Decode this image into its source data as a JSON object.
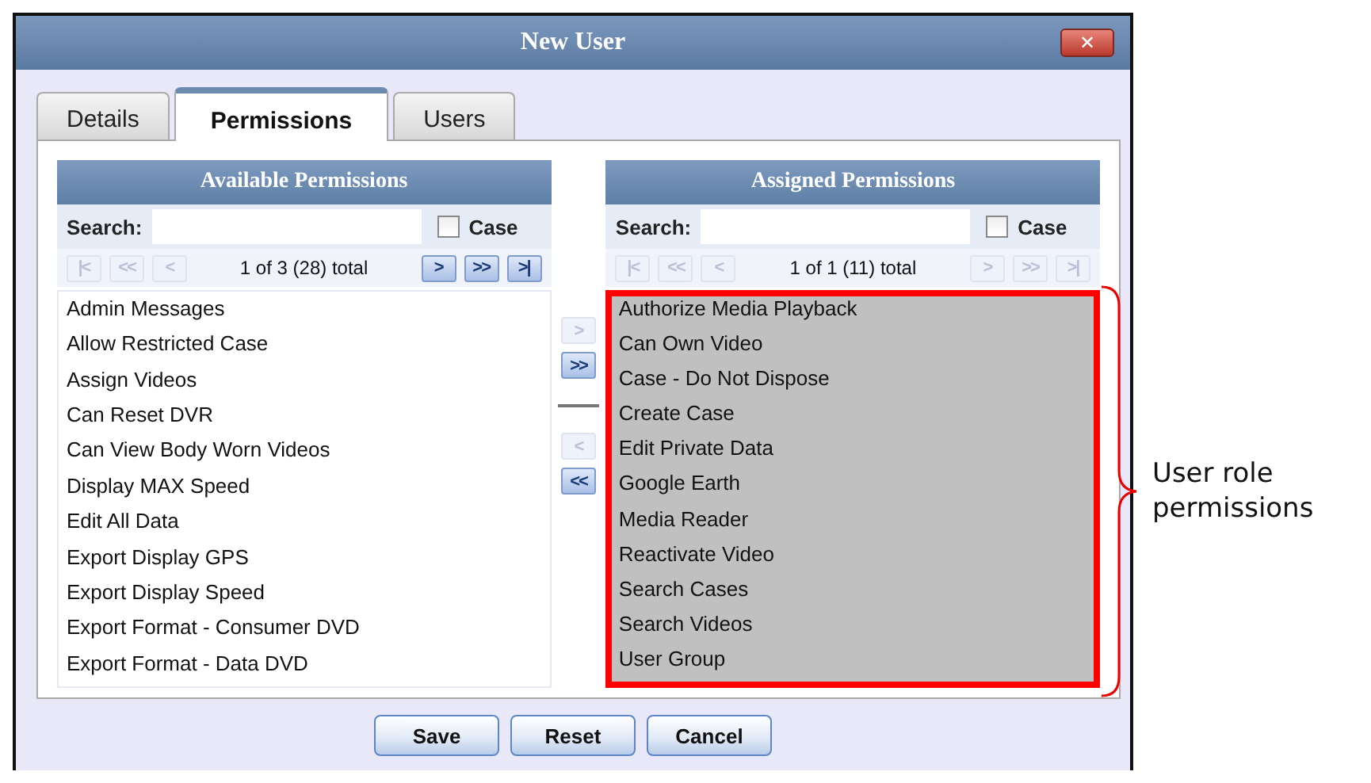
{
  "window": {
    "title": "New User",
    "close_label": "✕"
  },
  "tabs": [
    {
      "label": "Details",
      "selected": false
    },
    {
      "label": "Permissions",
      "selected": true
    },
    {
      "label": "Users",
      "selected": false
    }
  ],
  "panels": [
    {
      "title": "Available Permissions",
      "search_label": "Search:",
      "case_label": "Case",
      "case_checked": false,
      "highlighted": false,
      "pager": {
        "buttons": [
          {
            "label": "|<",
            "disabled": true
          },
          {
            "label": "<<",
            "disabled": true
          },
          {
            "label": "<",
            "disabled": true
          }
        ],
        "status": "1 of 3 (28) total",
        "buttons_after": [
          {
            "label": ">",
            "disabled": false
          },
          {
            "label": ">>",
            "disabled": false
          },
          {
            "label": ">|",
            "disabled": false
          }
        ]
      },
      "items": [
        "Admin Messages",
        "Allow Restricted Case",
        "Assign Videos",
        "Can Reset DVR",
        "Can View Body Worn Videos",
        "Display MAX Speed",
        "Edit All Data",
        "Export Display GPS",
        "Export Display Speed",
        "Export Format - Consumer DVD",
        "Export Format - Data DVD"
      ]
    },
    {
      "title": "Assigned Permissions",
      "search_label": "Search:",
      "case_label": "Case",
      "case_checked": false,
      "highlighted": true,
      "pager": {
        "buttons": [
          {
            "label": "|<",
            "disabled": true
          },
          {
            "label": "<<",
            "disabled": true
          },
          {
            "label": "<",
            "disabled": true
          }
        ],
        "status": "1 of 1 (11) total",
        "buttons_after": [
          {
            "label": ">",
            "disabled": true
          },
          {
            "label": ">>",
            "disabled": true
          },
          {
            "label": ">|",
            "disabled": true
          }
        ]
      },
      "items": [
        "Authorize Media Playback",
        "Can Own Video",
        "Case - Do Not Dispose",
        "Create Case",
        "Edit Private Data",
        "Google Earth",
        "Media Reader",
        "Reactivate Video",
        "Search Cases",
        "Search Videos",
        "User Group"
      ]
    }
  ],
  "transfer_buttons": [
    {
      "label": ">",
      "disabled": true
    },
    {
      "label": ">>",
      "disabled": false
    },
    {
      "label": "<",
      "disabled": true
    },
    {
      "label": "<<",
      "disabled": false
    }
  ],
  "buttons": [
    "Save",
    "Reset",
    "Cancel"
  ],
  "callout": {
    "text": "User role permissions"
  }
}
